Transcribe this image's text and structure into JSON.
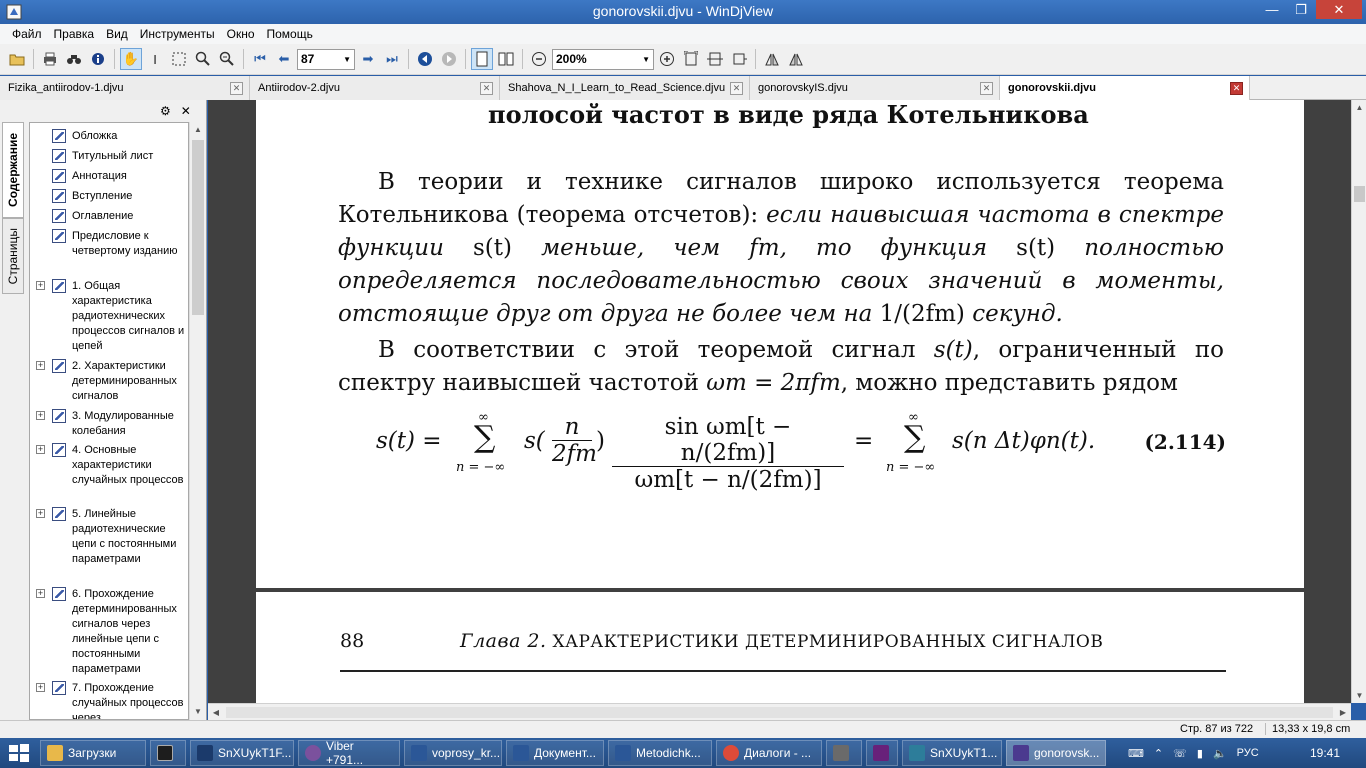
{
  "window": {
    "title": "gonorovskii.djvu - WinDjView",
    "min": "—",
    "max": "❐",
    "close": "✕"
  },
  "menu": [
    "Файл",
    "Правка",
    "Вид",
    "Инструменты",
    "Окно",
    "Помощь"
  ],
  "toolbar": {
    "page_value": "87",
    "zoom_value": "200%"
  },
  "tabs": [
    {
      "label": "Fizika_antiirodov-1.djvu",
      "active": false
    },
    {
      "label": "Antiirodov-2.djvu",
      "active": false
    },
    {
      "label": "Shahova_N_I_Learn_to_Read_Science.djvu",
      "active": false
    },
    {
      "label": "gonorovskyIS.djvu",
      "active": false
    },
    {
      "label": "gonorovskii.djvu",
      "active": true
    }
  ],
  "sidebar": {
    "tab_contents": "Содержание",
    "tab_pages": "Страницы",
    "items": [
      {
        "label": "Обложка",
        "expandable": false
      },
      {
        "label": "Титульный лист",
        "expandable": false
      },
      {
        "label": "Аннотация",
        "expandable": false
      },
      {
        "label": "Вступление",
        "expandable": false
      },
      {
        "label": "Оглавление",
        "expandable": false
      },
      {
        "label": "Предисловие к четвертому изданию",
        "expandable": false
      },
      {
        "label": "1. Общая характеристика радиотехнических процессов сигналов и цепей",
        "expandable": true
      },
      {
        "label": "2. Характеристики детерминированных сигналов",
        "expandable": true
      },
      {
        "label": "3. Модулированные колебания",
        "expandable": true
      },
      {
        "label": "4. Основные характеристики случайных процессов",
        "expandable": true
      },
      {
        "label": "5. Линейные радиотехнические цепи с постоянными параметрами",
        "expandable": true
      },
      {
        "label": "6. Прохождение детерминированных сигналов через линейные цепи с постоянными параметрами",
        "expandable": true
      },
      {
        "label": "7. Прохождение случайных процессов через",
        "expandable": true
      }
    ]
  },
  "document": {
    "heading": "полосой частот в виде ряда Котельникова",
    "p1_normal": "В теории и технике сигналов широко используется теорема Котельникова (теорема отсчетов): ",
    "p1_italic_a": "если наивысшая частота в спектре функции ",
    "p1_st1": "s(t)",
    "p1_italic_b": " меньше, чем ",
    "p1_fm": "fm",
    "p1_italic_c": ", то функция ",
    "p1_st2": "s(t)",
    "p1_italic_d": " полностью определяется последовательностью своих значений в моменты, отстоящие друг от друга не более чем на ",
    "p1_frac": "1/(2fm)",
    "p1_italic_e": " секунд.",
    "p2_a": "В соответствии с этой теоремой сигнал ",
    "p2_st": "s(t)",
    "p2_b": ", ограниченный по спектру наивысшей частотой ",
    "p2_omega": "ωm = 2πfm",
    "p2_c": ", можно представить рядом",
    "formula": {
      "lhs": "s(t) =",
      "sum_top": "∞",
      "sum_sign": "∑",
      "sum_bottom": "n = −∞",
      "s_paren": "s(",
      "inner_num": "n",
      "inner_den": "2fm",
      "close_paren": ")",
      "frac_num": "sin ωm[t − n/(2fm)]",
      "frac_den": "ωm[t − n/(2fm)]",
      "eq2": "=",
      "sum2_top": "∞",
      "sum2_bottom": "n = −∞",
      "rhs": "s(n Δt)φn(t).",
      "number": "(2.114)"
    },
    "page_number": "88",
    "chapter_italic": "Глава 2.",
    "chapter_title": " ХАРАКТЕРИСТИКИ ДЕТЕРМИНИРОВАННЫХ СИГНАЛОВ"
  },
  "status": {
    "page": "Стр. 87 из 722",
    "size": "13,33 x 19,8 cm"
  },
  "taskbar": {
    "items": [
      {
        "label": "Загрузки",
        "color": "#e8b84a"
      },
      {
        "label": "",
        "color": "#1d1d1d"
      },
      {
        "label": "SnXUykT1F...",
        "color": "#1b3a6b"
      },
      {
        "label": "Viber +791...",
        "color": "#7b519d"
      },
      {
        "label": "voprosy_kr...",
        "color": "#2b5797"
      },
      {
        "label": "Документ...",
        "color": "#2b5797"
      },
      {
        "label": "Metodichk...",
        "color": "#2b5797"
      },
      {
        "label": "Диалоги - ...",
        "color": "#dd4b39"
      },
      {
        "label": "",
        "color": "#6a6a6a"
      },
      {
        "label": "",
        "color": "#68217a"
      },
      {
        "label": "SnXUykT1...",
        "color": "#2d7d9a"
      },
      {
        "label": "gonorovsk...",
        "color": "#4b3a8f"
      }
    ],
    "lang": "РУС",
    "time": "19:41"
  }
}
